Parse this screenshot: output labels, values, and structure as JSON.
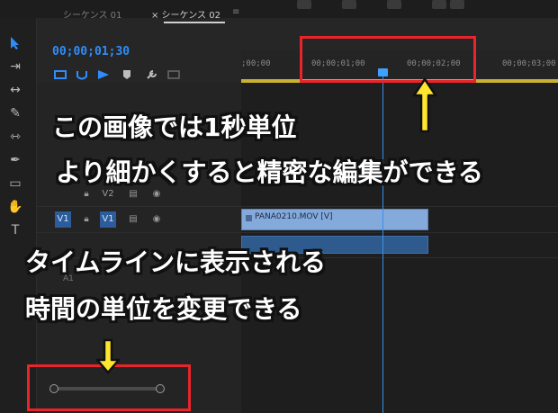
{
  "panel": {
    "tabs": [
      {
        "label": "シーケンス 01"
      },
      {
        "label": "× シーケンス 02"
      }
    ],
    "menu_glyph": "≡",
    "timecode": "00;00;01;30"
  },
  "ruler": {
    "ticks": [
      ";00;00",
      "00;00;01;00",
      "00;00;02;00",
      "00;00;03;00"
    ]
  },
  "tracks": {
    "v2": {
      "label": "V2"
    },
    "v1": {
      "label": "V1",
      "source_label": "V1"
    },
    "a1_label": "A1",
    "clip_label": "PANA0210.MOV [V]"
  },
  "annotations": {
    "caption1_line1": "この画像では1秒単位",
    "caption1_line2": "より細かくすると精密な編集ができる",
    "caption2_line1": "タイムラインに表示される",
    "caption2_line2": "時間の単位を変更できる"
  },
  "colors": {
    "accent_blue": "#2f8dfb",
    "callout_red": "#e8252b",
    "arrow_yellow": "#ffe62e",
    "work_area": "#c9b233"
  }
}
